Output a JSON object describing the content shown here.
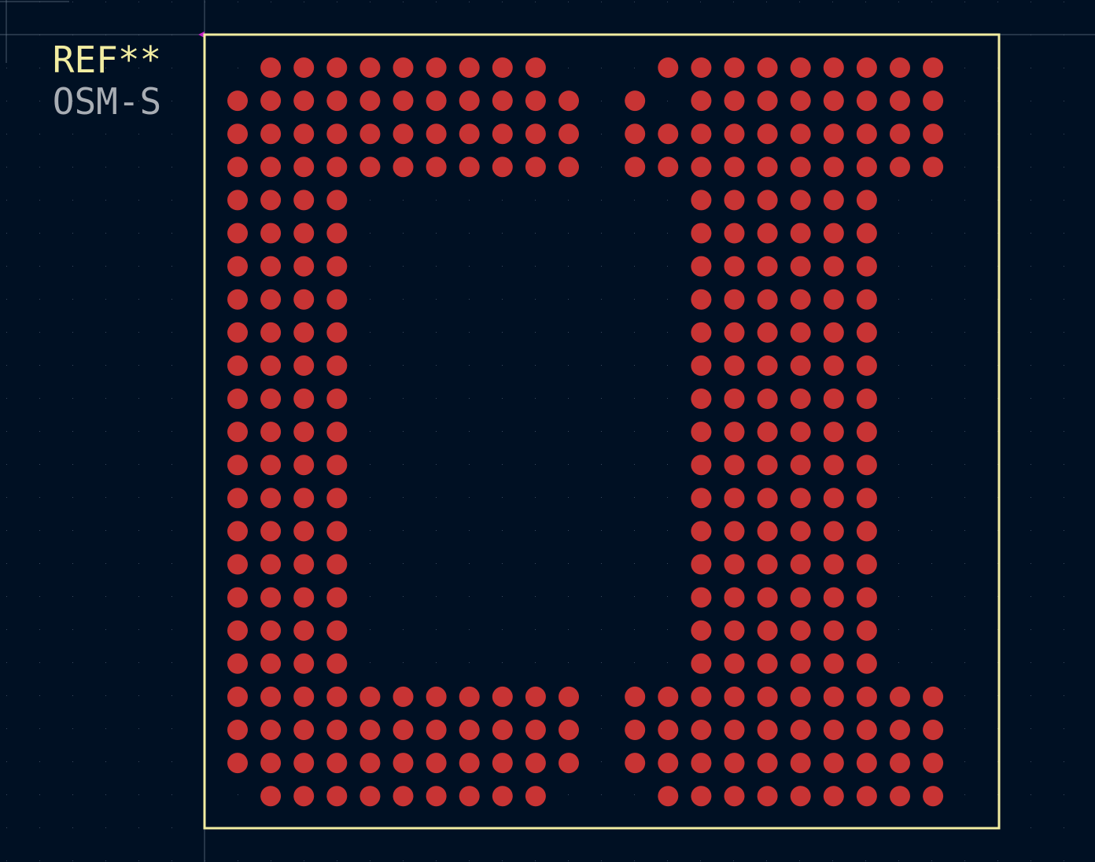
{
  "footprint": {
    "reference": "REF**",
    "value": "OSM-S"
  },
  "colors": {
    "background": "#001023",
    "grid_dot": "#3a4a5f",
    "courtyard_outline": "#f2eda1",
    "reference_text": "#f2eda1",
    "value_text": "#a8adb4",
    "pad": "#c83434",
    "crosshair": "#4a5a6e",
    "origin_marker": "#c020c0"
  },
  "icons": {
    "pad_shape": "circle",
    "origin": "crosshair-icon"
  },
  "pad_layout": {
    "columns": 22,
    "rows": 23,
    "row_masks": [
      "0111111111000111111111",
      "1111111111101011111111",
      "1111111111101111111111",
      "1111111111101111111111",
      "1111000000000011111100",
      "1111000000000011111100",
      "1111000000000011111100",
      "1111000000000011111100",
      "1111000000000011111100",
      "1111000000000011111100",
      "1111000000000011111100",
      "1111000000000011111100",
      "1111000000000011111100",
      "1111000000000011111100",
      "1111000000000011111100",
      "1111000000000011111100",
      "1111000000000011111100",
      "1111000000000011111100",
      "1111000000000011111100",
      "1111111111101111111111",
      "1111111111101111111111",
      "1111111111101111111111",
      "0111111111000111111111"
    ]
  }
}
